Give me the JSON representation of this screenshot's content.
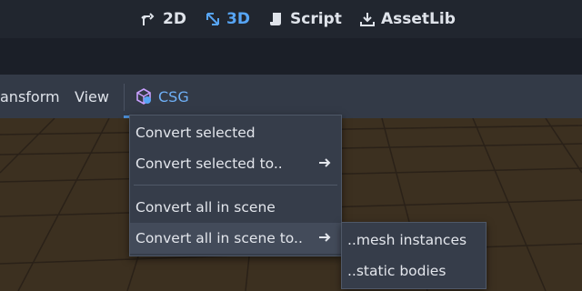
{
  "workspace_tabs": [
    {
      "label": "2D",
      "icon": "2d-move-icon",
      "active": false
    },
    {
      "label": "3D",
      "icon": "3d-axes-icon",
      "active": true
    },
    {
      "label": "Script",
      "icon": "script-scroll-icon",
      "active": false
    },
    {
      "label": "AssetLib",
      "icon": "download-icon",
      "active": false
    }
  ],
  "menubar": {
    "transform_label": "ansform",
    "view_label": "View",
    "csg_label": "CSG",
    "csg_icon": "csg-cube-icon"
  },
  "csg_menu": {
    "items": [
      {
        "label": "Convert selected",
        "has_submenu": false
      },
      {
        "label": "Convert selected to..",
        "has_submenu": true
      },
      {
        "label": "Convert all in scene",
        "has_submenu": false
      },
      {
        "label": "Convert all in scene to..",
        "has_submenu": true,
        "highlighted": true
      }
    ]
  },
  "submenu": {
    "items": [
      {
        "label": "..mesh instances"
      },
      {
        "label": "..static bodies"
      }
    ]
  },
  "colors": {
    "accent": "#57a5f5",
    "viewport_floor": "#3c3020",
    "grid_line": "#2a2118"
  }
}
